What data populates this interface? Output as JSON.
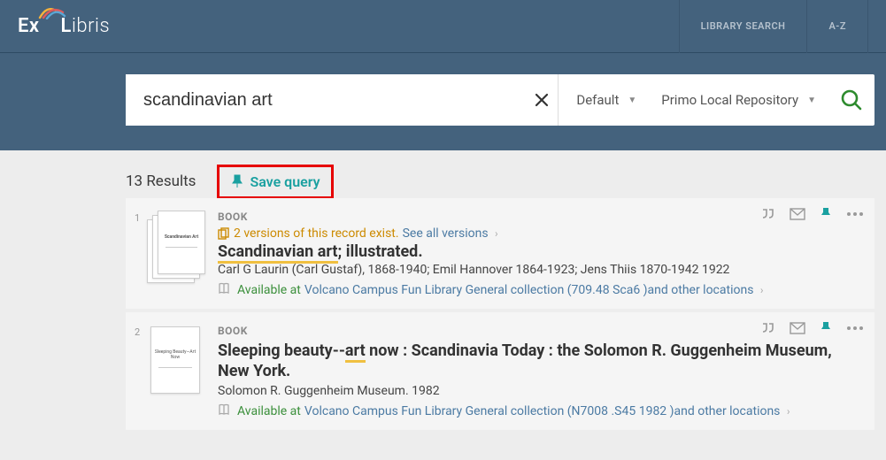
{
  "header": {
    "logo_prefix": "Ex",
    "logo_suffix": "ibris",
    "nav": [
      "LIBRARY SEARCH",
      "A-Z"
    ]
  },
  "search": {
    "query": "scandinavian art",
    "scope1": "Default",
    "scope2": "Primo Local Repository"
  },
  "results_header": {
    "count_text": "13 Results",
    "save_label": "Save query"
  },
  "results": [
    {
      "index": "1",
      "type": "BOOK",
      "versions_text": "2 versions of this record exist.",
      "see_all": "See all versions",
      "title_hl": "Scandinavian art",
      "title_rest": "; illustrated.",
      "authors": "Carl G Laurin (Carl Gustaf), 1868-1940; Emil Hannover 1864-1923; Jens Thiis 1870-1942 1922",
      "avail_label": "Available at",
      "avail_location": "Volcano Campus Fun Library General collection (709.48 Sca6 )and other locations",
      "thumb_title": "Scandinavian Art"
    },
    {
      "index": "2",
      "type": "BOOK",
      "title_pre": "Sleeping beauty--",
      "title_hl": "art",
      "title_post": " now : Scandinavia Today : the Solomon R. Guggenheim Museum, New York.",
      "authors": "Solomon R. Guggenheim Museum. 1982",
      "avail_label": "Available at",
      "avail_location": "Volcano Campus Fun Library General collection (N7008 .S45 1982 )and other locations",
      "thumb_title": "Sleeping Beauty—Art Now"
    }
  ]
}
